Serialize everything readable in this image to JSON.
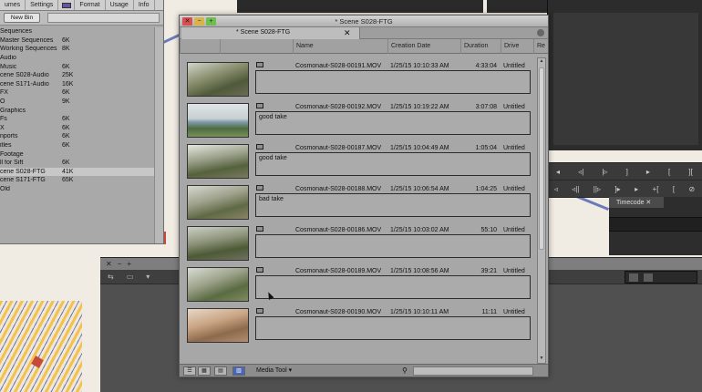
{
  "bin_panel": {
    "tabs": [
      "umes",
      "Settings",
      "",
      "Format",
      "Usage",
      "Info"
    ],
    "new_bin_label": "New Bin",
    "items": [
      {
        "name": "Sequences",
        "size": ""
      },
      {
        "name": "Master Sequences",
        "size": "6K"
      },
      {
        "name": "Working Sequences",
        "size": "8K"
      },
      {
        "name": "Audio",
        "size": ""
      },
      {
        "name": "Music",
        "size": "6K"
      },
      {
        "name": "cene S028-Audio",
        "size": "25K"
      },
      {
        "name": "cene S171-Audio",
        "size": "16K"
      },
      {
        "name": "FX",
        "size": "6K"
      },
      {
        "name": "O",
        "size": "9K"
      },
      {
        "name": "Graphics",
        "size": ""
      },
      {
        "name": "Fs",
        "size": "6K"
      },
      {
        "name": "X",
        "size": "6K"
      },
      {
        "name": "nports",
        "size": "6K"
      },
      {
        "name": "itles",
        "size": "6K"
      },
      {
        "name": "Footage",
        "size": ""
      },
      {
        "name": "ll for Sift",
        "size": "6K"
      },
      {
        "name": "cene S028-FTG",
        "size": "41K"
      },
      {
        "name": "cene S171-FTG",
        "size": "65K"
      },
      {
        "name": "Old",
        "size": ""
      }
    ]
  },
  "bin_window": {
    "title": "* Scene S028-FTG",
    "tab_label": "* Scene S028-FTG",
    "columns": [
      "Name",
      "Creation Date",
      "Duration",
      "Drive",
      "Re"
    ],
    "footer_mode": "Media Tool",
    "clips": [
      {
        "name": "Cosmonaut-S028-00191.MOV",
        "date": "1/25/15 10:10:33 AM",
        "duration": "4:33:04",
        "drive": "Untitled",
        "comment": ""
      },
      {
        "name": "Cosmonaut-S028-00192.MOV",
        "date": "1/25/15 10:19:22 AM",
        "duration": "3:07:08",
        "drive": "Untitled",
        "comment": "good take"
      },
      {
        "name": "Cosmonaut-S028-00187.MOV",
        "date": "1/25/15 10:04:49 AM",
        "duration": "1:05:04",
        "drive": "Untitled",
        "comment": "good take"
      },
      {
        "name": "Cosmonaut-S028-00188.MOV",
        "date": "1/25/15 10:06:54 AM",
        "duration": "1:04:25",
        "drive": "Untitled",
        "comment": "bad take"
      },
      {
        "name": "Cosmonaut-S028-00186.MOV",
        "date": "1/25/15 10:03:02 AM",
        "duration": "55:10",
        "drive": "Untitled",
        "comment": ""
      },
      {
        "name": "Cosmonaut-S028-00189.MOV",
        "date": "1/25/15 10:08:56 AM",
        "duration": "39:21",
        "drive": "Untitled",
        "comment": ""
      },
      {
        "name": "Cosmonaut-S028-00190.MOV",
        "date": "1/25/15 10:10:11 AM",
        "duration": "11:11",
        "drive": "Untitled",
        "comment": ""
      }
    ]
  },
  "timecode_panel": {
    "tab_label": "Timecode"
  },
  "colors": {
    "accent": "#4a66b8",
    "close": "#d94e4e",
    "minimize": "#d9b44a",
    "maximize": "#6fbf4e"
  }
}
